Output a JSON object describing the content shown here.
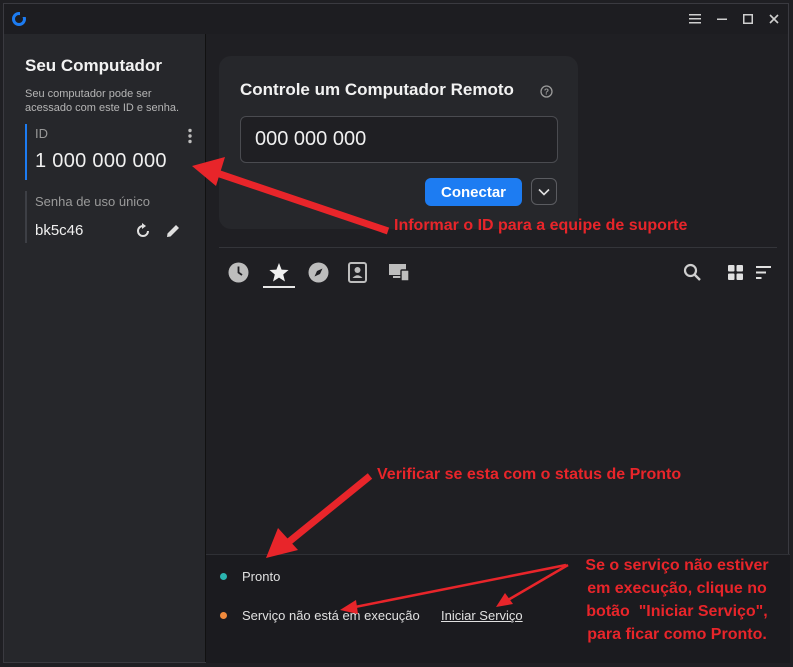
{
  "sidebar": {
    "title": "Seu Computador",
    "description": "Seu computador pode ser acessado com este ID e senha.",
    "id_label": "ID",
    "id_value": "1 000 000 000",
    "password_label": "Senha de uso único",
    "password_value": "bk5c46"
  },
  "remote": {
    "title": "Controle um Computador Remoto",
    "input_value": "000 000 000",
    "connect_label": "Conectar"
  },
  "tabs": [
    {
      "icon": "clock-icon"
    },
    {
      "icon": "star-icon"
    },
    {
      "icon": "compass-icon"
    },
    {
      "icon": "address-book-icon"
    },
    {
      "icon": "devices-icon"
    }
  ],
  "status": {
    "ready_text": "Pronto",
    "ready_color": "#2bb5b0",
    "service_text": "Serviço não está em execução",
    "service_color": "#f08a3c",
    "start_service_label": "Iniciar Serviço"
  },
  "annotations": {
    "id_note": "Informar o ID para a equipe de suporte",
    "status_note": "Verificar se esta com o status de Pronto",
    "service_note_1": "Se o serviço não estiver",
    "service_note_2": "em execução, clique no",
    "service_note_3": "botão  \"Iniciar Serviço\",",
    "service_note_4": "para ficar como Pronto."
  },
  "colors": {
    "accent": "#1d7cf2",
    "annotation": "#e8252a",
    "background": "#1f1f23",
    "sidebar": "#26272b"
  }
}
